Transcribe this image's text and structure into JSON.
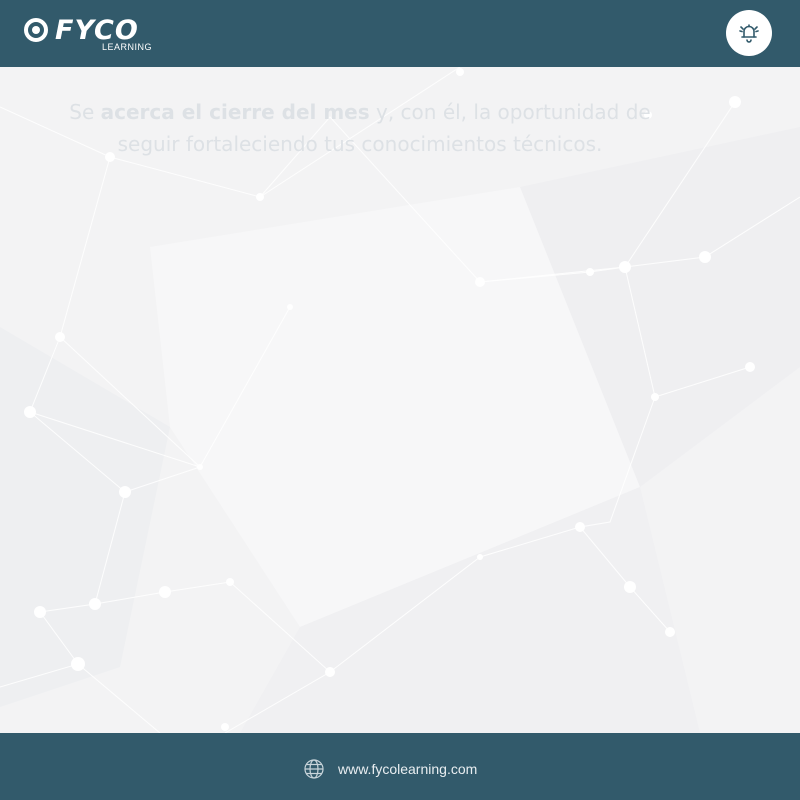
{
  "brand": {
    "name": "FYCO",
    "sub": "LEARNING"
  },
  "header": {
    "bell_icon": "bell-ringing-icon"
  },
  "headline": {
    "part1": "Se ",
    "bold": "acerca el cierre del mes",
    "part2": " y, con él, la oportunidad de seguir fortaleciendo tus conocimientos técnicos."
  },
  "footer": {
    "globe_icon": "globe-icon",
    "website": "www.fycolearning.com"
  },
  "colors": {
    "bar": "#325a6b",
    "background": "#f3f3f4",
    "headline_text": "#dde1e5"
  }
}
